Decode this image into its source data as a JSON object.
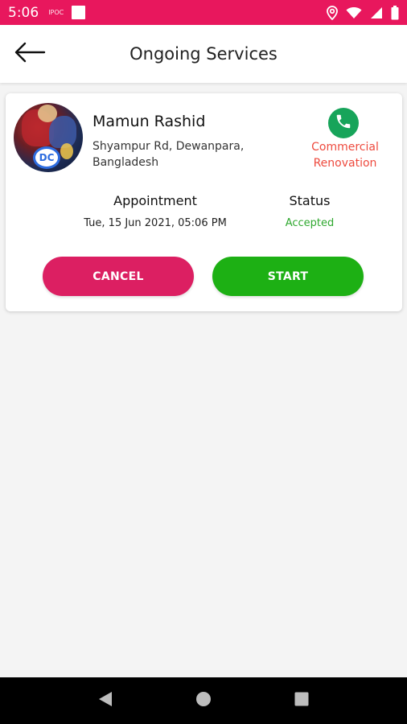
{
  "status_bar": {
    "time": "5:06",
    "tag": "IPOC"
  },
  "app_bar": {
    "title": "Ongoing Services"
  },
  "service_card": {
    "customer_name": "Mamun Rashid",
    "address": "Shyampur Rd, Dewanpara, Bangladesh",
    "service_type": "Commercial Renovation",
    "appointment_label": "Appointment",
    "appointment_value": "Tue, 15 Jun 2021, 05:06 PM",
    "status_label": "Status",
    "status_value": "Accepted",
    "cancel_label": "CANCEL",
    "start_label": "START"
  },
  "colors": {
    "status_bar": "#e8175d",
    "cancel": "#dc1f62",
    "start": "#1db014",
    "call": "#17a45a",
    "service_type": "#ee4a3e",
    "status_accepted": "#2fa82f"
  },
  "icons": {
    "back": "arrow-left-icon",
    "call": "phone-icon",
    "nav_back": "triangle-back-icon",
    "nav_home": "circle-home-icon",
    "nav_recent": "square-recent-icon"
  }
}
